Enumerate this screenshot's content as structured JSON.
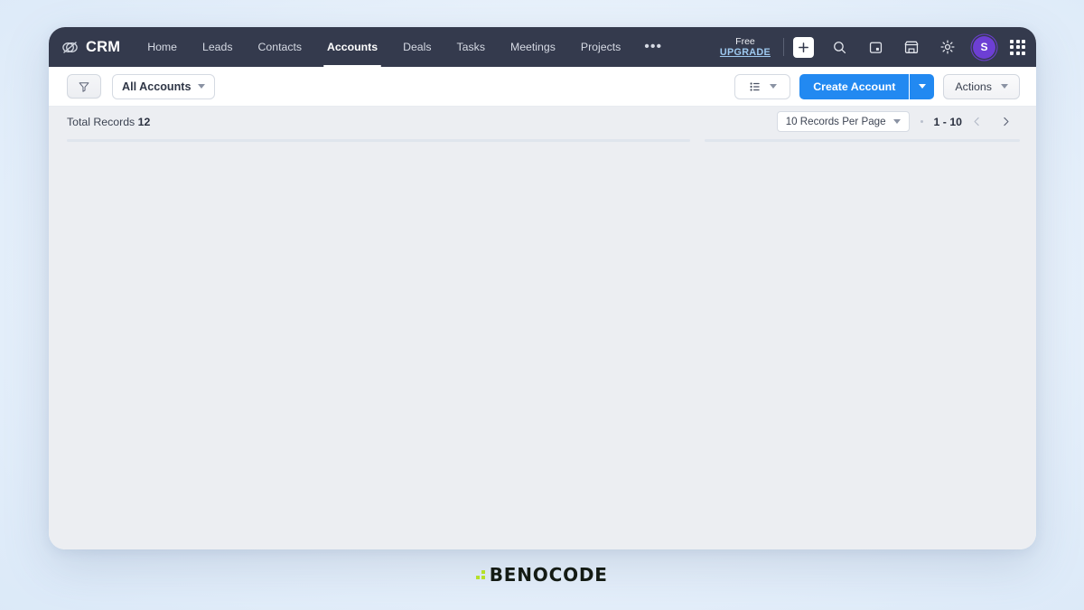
{
  "app": {
    "brand": "CRM",
    "brand_icon": "linked-rings-icon"
  },
  "topnav": {
    "items": [
      {
        "label": "Home",
        "active": false
      },
      {
        "label": "Leads",
        "active": false
      },
      {
        "label": "Contacts",
        "active": false
      },
      {
        "label": "Accounts",
        "active": true
      },
      {
        "label": "Deals",
        "active": false
      },
      {
        "label": "Tasks",
        "active": false
      },
      {
        "label": "Meetings",
        "active": false
      },
      {
        "label": "Projects",
        "active": false
      }
    ],
    "more_label": "•••",
    "upgrade": {
      "plan": "Free",
      "action": "UPGRADE"
    },
    "icons": [
      "plus-icon",
      "search-icon",
      "calendar-icon",
      "marketplace-icon",
      "gear-icon"
    ],
    "avatar_initial": "S",
    "apps_icon": "app-grid-icon"
  },
  "toolbar": {
    "filter_icon": "funnel-icon",
    "view_selector": "All Accounts",
    "list_view_icon": "list-view-icon",
    "create_label": "Create Account",
    "actions_label": "Actions"
  },
  "records": {
    "total_label": "Total Records",
    "total_count": "12",
    "per_page": "10 Records Per Page",
    "range": "1 - 10",
    "prev_icon": "chevron-left-icon",
    "next_icon": "chevron-right-icon"
  },
  "footer": {
    "logo_text": "BENOCODE"
  },
  "colors": {
    "nav_bg": "#343a4d",
    "primary": "#2289f1",
    "avatar": "#6d3fd4",
    "content_bg": "#eceef2",
    "accent_green": "#b6e02a",
    "upgrade_link": "#9ec9f0"
  }
}
